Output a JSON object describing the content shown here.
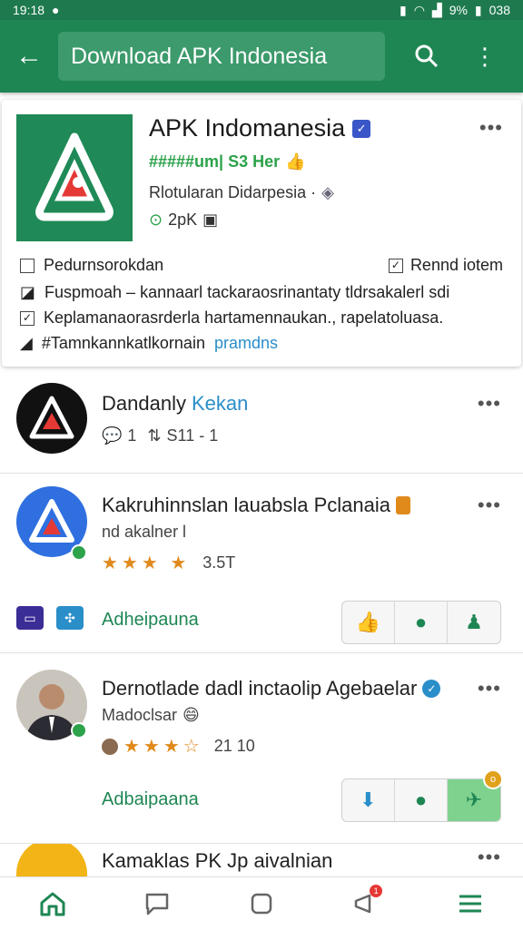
{
  "status_bar": {
    "time": "19:18",
    "battery": "9%",
    "clock_right": "038"
  },
  "app_bar": {
    "search_text": "Download APK Indonesia"
  },
  "top_card": {
    "title": "APK Indomanesia",
    "rating_line": "#####um| S3 Her",
    "developer": "Rlotularan Didarpesia ·",
    "size": "2pK",
    "features": [
      {
        "label": "Pedurnsorokdan",
        "right": "Rennd iotem"
      },
      {
        "label": "Fuspmoah – kannaarl tackaraosrinantaty tldrsakalerl sdi",
        "right": ""
      },
      {
        "label": "Keplamanaorasrderla hartamennaukan., rapelatoluasa.",
        "right": ""
      },
      {
        "label": "#Tamnkannkatlkornain",
        "right": "pramdns"
      }
    ]
  },
  "items": [
    {
      "title": "Dandanly",
      "title_link": "Kekan",
      "meta_comments": "1",
      "meta_shares": "S11 - 1"
    },
    {
      "title": "Kakruhinnslan lauabsla Pclanaia",
      "subtitle": "nd akalner l",
      "rating": "3.5T",
      "action_label": "Adheipauna"
    },
    {
      "title": "Dernotlade dadl inctaolip Agebaelar",
      "subtitle": "Madoclsar",
      "rating": "21 10",
      "action_label": "Adbaipaana"
    },
    {
      "title": "Kamaklas PK Jp aivalnian"
    }
  ],
  "bottom_nav": {
    "badge": "1"
  },
  "colors": {
    "primary": "#1e8653",
    "accent_blue": "#2a8ec9",
    "star": "#e08a1c"
  }
}
